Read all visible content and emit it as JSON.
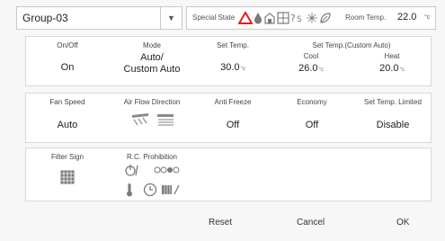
{
  "header": {
    "group_value": "Group-03",
    "special_state_label": "Special State",
    "room_temp_label": "Room Temp.",
    "room_temp_value": "22.0",
    "room_temp_unit": "°c",
    "special_state_icons": [
      "warning-triangle-icon",
      "drop-icon",
      "building-icon",
      "grid-icon",
      "schedule-question-icon",
      "fan-icon",
      "leaf-icon"
    ]
  },
  "panel1": {
    "onoff": {
      "label": "On/Off",
      "value": "On"
    },
    "mode": {
      "label": "Mode",
      "value_line1": "Auto/",
      "value_line2": "Custom Auto"
    },
    "set_temp": {
      "label": "Set Temp.",
      "value": "30.0",
      "unit": "°c"
    },
    "custom_auto": {
      "label": "Set Temp.(Custom Auto)",
      "cool_label": "Cool",
      "cool_value": "26.0",
      "cool_unit": "°c",
      "heat_label": "Heat",
      "heat_value": "20.0",
      "heat_unit": "°c"
    }
  },
  "panel2": {
    "fan_speed": {
      "label": "Fan Speed",
      "value": "Auto"
    },
    "air_flow": {
      "label": "Air Flow Direction"
    },
    "anti_freeze": {
      "label": "Anti Freeze",
      "value": "Off"
    },
    "economy": {
      "label": "Economy",
      "value": "Off"
    },
    "set_temp_limited": {
      "label": "Set Temp. Limited",
      "value": "Disable"
    }
  },
  "panel3": {
    "filter_sign": {
      "label": "Filter Sign"
    },
    "rc_prohibition": {
      "label": "R.C. Prohibition"
    }
  },
  "buttons": {
    "reset": "Reset",
    "cancel": "Cancel",
    "ok": "OK"
  },
  "colors": {
    "warning": "#e0201a",
    "icon_gray": "#7a7a7a",
    "border": "#c8c8c8"
  }
}
